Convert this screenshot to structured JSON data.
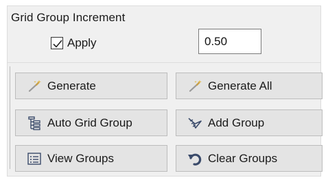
{
  "panel": {
    "title": "Grid Group Increment",
    "apply_label": "Apply",
    "apply_checked": true,
    "increment_value": "0.50"
  },
  "buttons": {
    "generate": {
      "label": "Generate",
      "icon": "wand-icon"
    },
    "generate_all": {
      "label": "Generate All",
      "icon": "wand-icon"
    },
    "auto_grid_group": {
      "label": "Auto Grid Group",
      "icon": "tree-list-icon"
    },
    "add_group": {
      "label": "Add Group",
      "icon": "add-group-icon"
    },
    "view_groups": {
      "label": "View Groups",
      "icon": "list-window-icon"
    },
    "clear_groups": {
      "label": "Clear Groups",
      "icon": "undo-arrow-icon"
    }
  },
  "colors": {
    "panel_bg": "#f0f0f0",
    "button_bg": "#e4e4e4",
    "button_border": "#bcbcbc",
    "icon_dark": "#3a4a6a"
  }
}
